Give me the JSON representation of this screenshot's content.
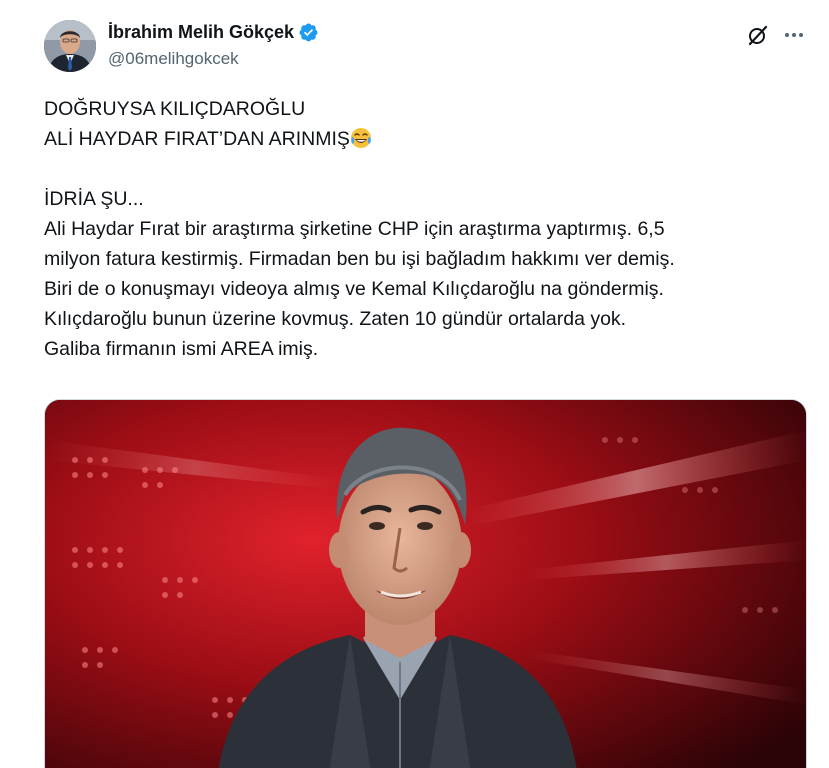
{
  "author": {
    "display_name": "İbrahim Melih Gökçek",
    "handle": "@06melihgokcek",
    "verified": true,
    "verified_color": "#1d9bf0"
  },
  "actions": {
    "grok_icon": "grok-icon",
    "more_icon": "more-icon"
  },
  "tweet": {
    "paragraph1": [
      "DOĞRUYSA KILIÇDAROĞLU",
      "ALİ HAYDAR FIRAT’DAN ARINMIŞ"
    ],
    "emoji": "face-with-tears-of-joy",
    "paragraph2": [
      "İDRİA ŞU...",
      "Ali Haydar Fırat bir araştırma şirketine CHP için araştırma yaptırmış. 6,5",
      "milyon fatura kestirmiş. Firmadan ben bu işi bağladım hakkımı ver demiş.",
      "Biri de o konuşmayı videoya almış ve Kemal Kılıçdaroğlu na göndermiş.",
      "Kılıçdaroğlu bunun üzerine kovmuş. Zaten 10 gündür ortalarda yok.",
      "Galiba firmanın ismi AREA imiş."
    ]
  },
  "media": {
    "type": "photo",
    "background_color": "#b3121c"
  }
}
